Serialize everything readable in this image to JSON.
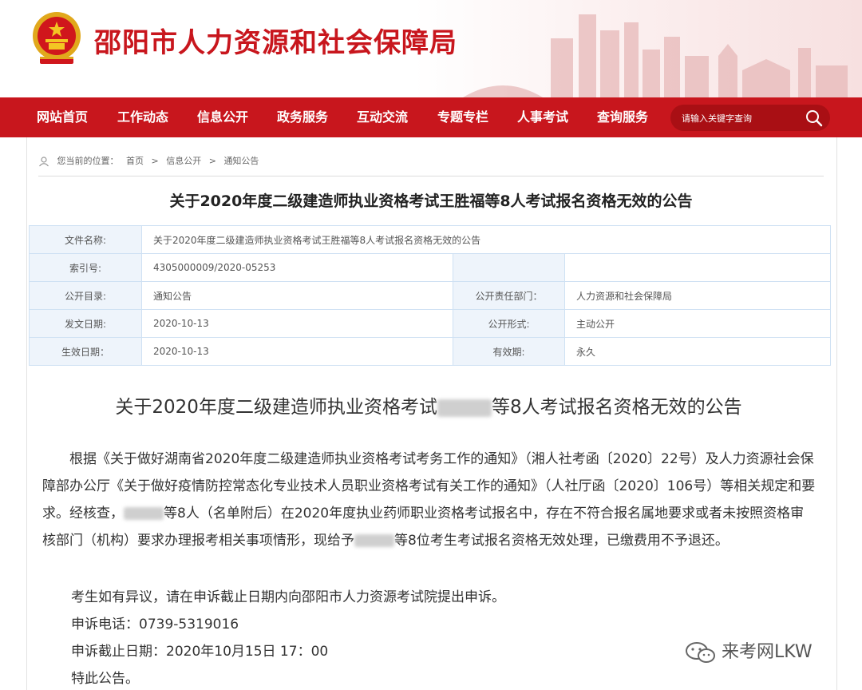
{
  "header": {
    "site_title": "邵阳市人力资源和社会保障局"
  },
  "nav": {
    "items": [
      "网站首页",
      "工作动态",
      "信息公开",
      "政务服务",
      "互动交流",
      "专题专栏",
      "人事考试",
      "查询服务"
    ],
    "search_placeholder": "请输入关键字查询"
  },
  "breadcrumb": {
    "prefix": "您当前的位置：",
    "items": [
      "首页",
      "信息公开",
      "通知公告"
    ],
    "separator": ">"
  },
  "doc": {
    "title": "关于2020年度二级建造师执业资格考试王胜福等8人考试报名资格无效的公告"
  },
  "info_table": {
    "file_name_label": "文件名称:",
    "file_name": "关于2020年度二级建造师执业资格考试王胜福等8人考试报名资格无效的公告",
    "index_label": "索引号:",
    "index": "4305000009/2020-05253",
    "catalog_label": "公开目录:",
    "catalog": "通知公告",
    "dept_label": "公开责任部门：",
    "dept": "人力资源和社会保障局",
    "issue_label": "发文日期:",
    "issue": "2020-10-13",
    "form_label": "公开形式:",
    "form": "主动公开",
    "effective_label": "生效日期：",
    "effective": "2020-10-13",
    "validity_label": "有效期:",
    "validity": "永久"
  },
  "article": {
    "title_a": "关于2020年度二级建造师执业资格考试",
    "title_b": "等8人考试报名资格无效的公告",
    "p1_a": "根据《关于做好湖南省2020年度二级建造师执业资格考试考务工作的通知》（湘人社考函〔2020〕22号）及人力资源社会保障部办公厅《关于做好疫情防控常态化专业技术人员职业资格考试有关工作的通知》（人社厅函〔2020〕106号）等相关规定和要求。经核查，",
    "p1_b": "等8人（名单附后）在2020年度执业药师职业资格考试报名中，存在不符合报名属地要求或者未按照资格审核部门（机构）要求办理报考相关事项情形，现给予",
    "p1_c": "等8位考生考试报名资格无效处理，已缴费用不予退还。",
    "p2": "考生如有异议，请在申诉截止日期内向邵阳市人力资源考试院提出申诉。",
    "phone": "申诉电话：0739-5319016",
    "deadline": "申诉截止日期：2020年10月15日 17：00",
    "closing": "特此公告。"
  },
  "watermark": "来考网LKW",
  "colors": {
    "brand_red": "#c8161d",
    "table_border": "#cfe1f3",
    "label_bg": "#eef4fb"
  }
}
